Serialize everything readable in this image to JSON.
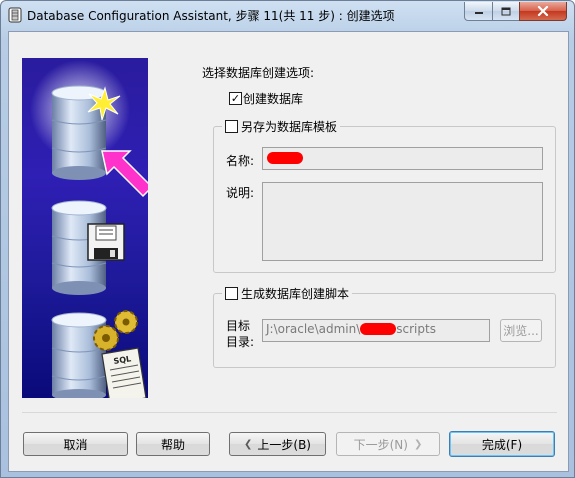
{
  "window": {
    "title": "Database Configuration Assistant, 步骤 11(共 11 步) : 创建选项"
  },
  "titlebar_buttons": {
    "minimize_icon": "minimize-icon",
    "maximize_icon": "maximize-icon",
    "close_icon": "close-icon"
  },
  "illustration": {
    "sql_label": "SQL"
  },
  "content": {
    "heading": "选择数据库创建选项:",
    "create_db": {
      "label": "创建数据库",
      "checked": true
    },
    "save_template": {
      "label": "另存为数据库模板",
      "checked": false,
      "name_label": "名称:",
      "desc_label": "说明:"
    },
    "gen_scripts": {
      "label": "生成数据库创建脚本",
      "checked": false,
      "dest_label_line1": "目标",
      "dest_label_line2": "目录:",
      "path_prefix": "J:\\oracle\\admin\\",
      "path_suffix": "scripts",
      "browse_label": "浏览..."
    }
  },
  "buttons": {
    "cancel": "取消",
    "help": "帮助",
    "back": "上一步(B)",
    "next": "下一步(N)",
    "finish": "完成(F)"
  },
  "colors": {
    "redaction": "#ff0000",
    "illustration_bg": "#2f1fb4",
    "arrow": "#ff33cc"
  }
}
